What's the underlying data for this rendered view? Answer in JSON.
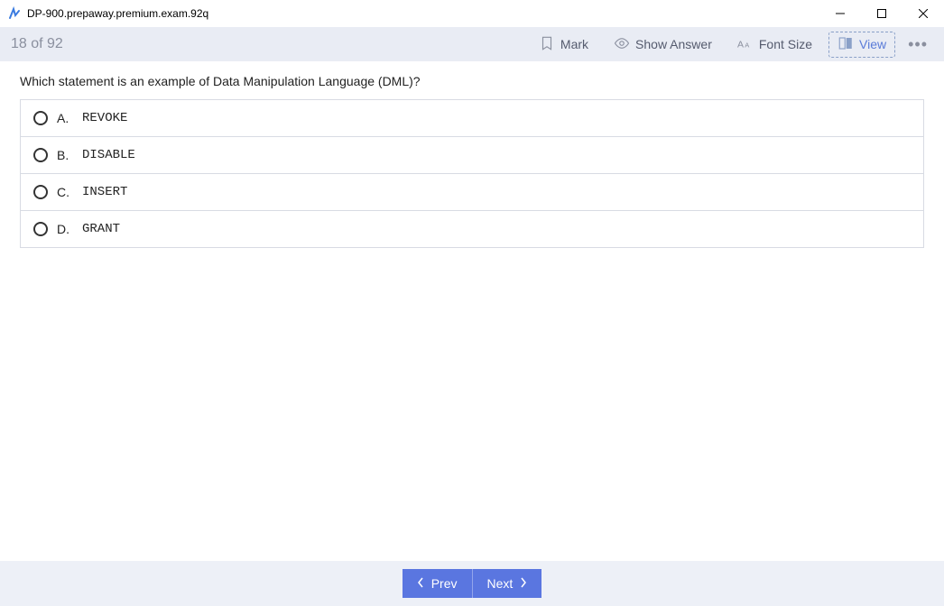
{
  "window": {
    "title": "DP-900.prepaway.premium.exam.92q"
  },
  "toolbar": {
    "progress": "18 of 92",
    "mark_label": "Mark",
    "show_answer_label": "Show Answer",
    "font_size_label": "Font Size",
    "view_label": "View"
  },
  "question": {
    "text": "Which statement is an example of Data Manipulation Language (DML)?",
    "choices": [
      {
        "letter": "A.",
        "text": "REVOKE"
      },
      {
        "letter": "B.",
        "text": "DISABLE"
      },
      {
        "letter": "C.",
        "text": "INSERT"
      },
      {
        "letter": "D.",
        "text": "GRANT"
      }
    ]
  },
  "footer": {
    "prev_label": "Prev",
    "next_label": "Next"
  }
}
